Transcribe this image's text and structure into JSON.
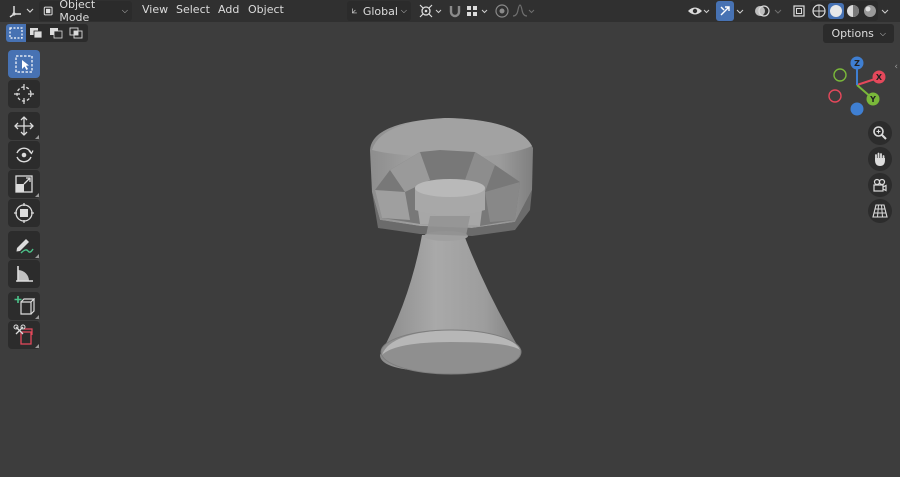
{
  "header": {
    "editor_type_icon": "3d-viewport-icon",
    "mode_label": "Object Mode",
    "menus": [
      "View",
      "Select",
      "Add",
      "Object"
    ],
    "transform_orientation": "Global"
  },
  "row2": {
    "options_label": "Options"
  },
  "toolbar": {
    "tools": [
      "select-box",
      "cursor",
      "move",
      "rotate",
      "scale",
      "transform",
      "annotate",
      "measure",
      "add-cube",
      "add-object"
    ]
  },
  "gizmo": {
    "x_label": "X",
    "y_label": "Y",
    "z_label": "Z",
    "colors": {
      "x": "#e5485b",
      "y": "#7ab83a",
      "z": "#3f7fd2"
    }
  },
  "colors": {
    "accent": "#4772b3",
    "background": "#3d3d3d",
    "header": "#303030"
  }
}
